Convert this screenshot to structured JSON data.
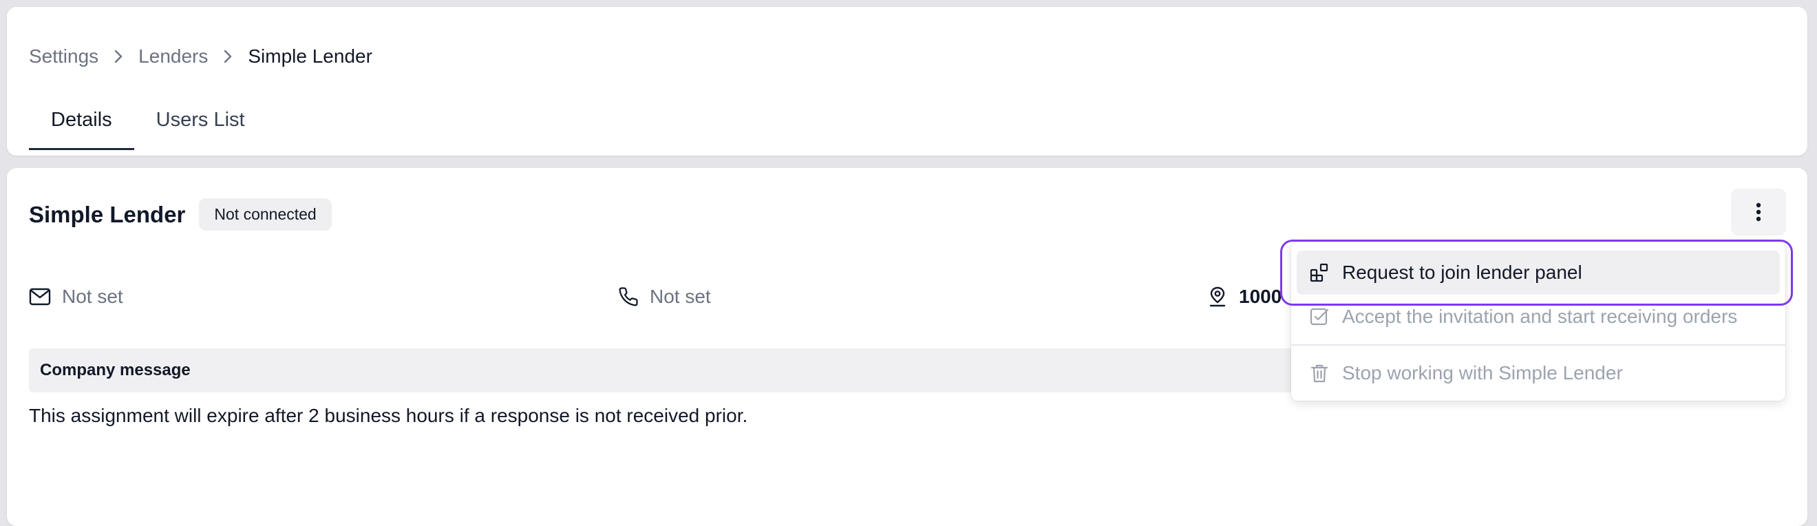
{
  "breadcrumb": [
    {
      "label": "Settings"
    },
    {
      "label": "Lenders"
    },
    {
      "label": "Simple Lender"
    }
  ],
  "tabs": [
    {
      "label": "Details",
      "active": true
    },
    {
      "label": "Users List",
      "active": false
    }
  ],
  "lender": {
    "name": "Simple Lender",
    "status": "Not connected",
    "email": "Not set",
    "phone": "Not set",
    "address": "1000"
  },
  "company_message": {
    "heading": "Company message",
    "text": "This assignment will expire after 2 business hours if a response is not received prior."
  },
  "menu": {
    "items": [
      {
        "label": "Request to join lender panel",
        "icon": "request-join-icon",
        "enabled": true
      },
      {
        "label": "Accept the invitation and start receiving orders",
        "icon": "checkbox-icon",
        "enabled": false
      },
      {
        "label": "Stop working with Simple Lender",
        "icon": "trash-icon",
        "enabled": false
      }
    ]
  },
  "colors": {
    "focus_ring": "#7c3aed",
    "background": "#e4e4e9"
  }
}
